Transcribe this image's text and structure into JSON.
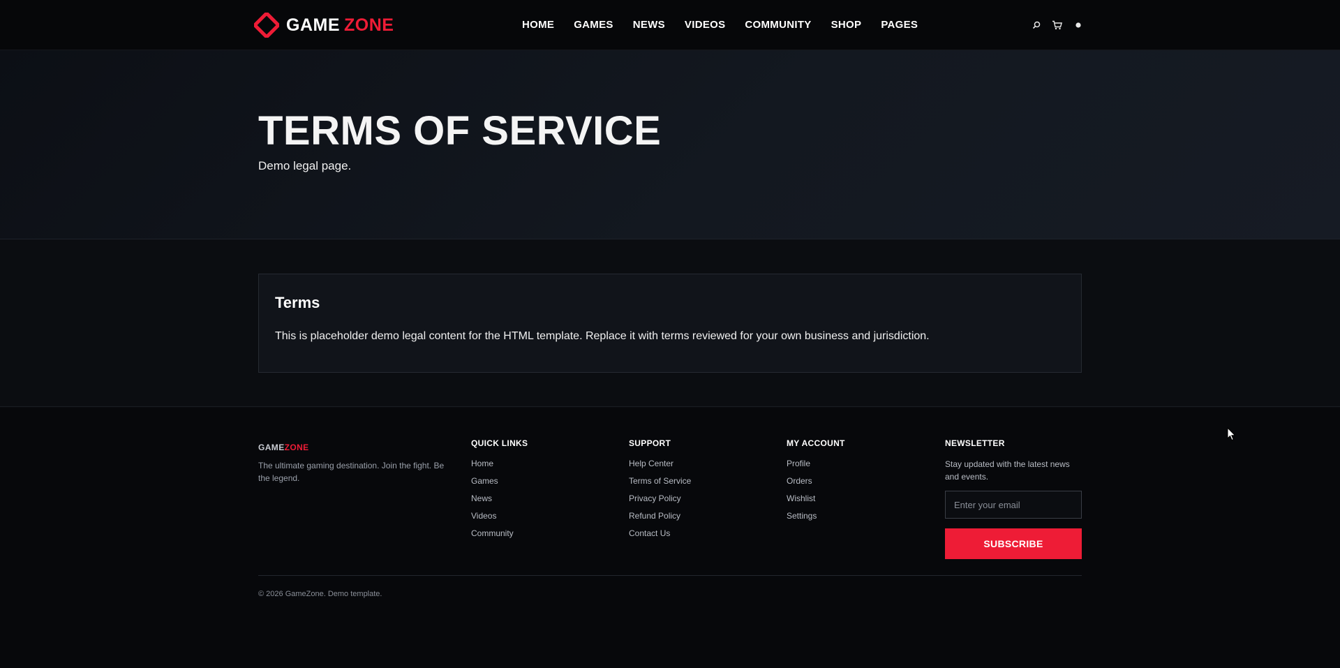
{
  "header": {
    "logo": {
      "word1": "GAME",
      "word2": "ZONE"
    },
    "nav": [
      {
        "label": "HOME"
      },
      {
        "label": "GAMES"
      },
      {
        "label": "NEWS"
      },
      {
        "label": "VIDEOS"
      },
      {
        "label": "COMMUNITY"
      },
      {
        "label": "SHOP"
      },
      {
        "label": "PAGES"
      }
    ],
    "icons": {
      "search": "⌕",
      "cart": "🛒",
      "account": "●"
    }
  },
  "hero": {
    "title": "TERMS OF SERVICE",
    "subtitle": "Demo legal page."
  },
  "content": {
    "card_title": "Terms",
    "card_text": "This is placeholder demo legal content for the HTML template. Replace it with terms reviewed for your own business and jurisdiction."
  },
  "footer": {
    "brand": {
      "word1": "GAME",
      "word2": "ZONE",
      "tagline": "The ultimate gaming destination. Join the fight. Be the legend."
    },
    "quick_links": {
      "title": "QUICK LINKS",
      "items": [
        "Home",
        "Games",
        "News",
        "Videos",
        "Community"
      ]
    },
    "support": {
      "title": "SUPPORT",
      "items": [
        "Help Center",
        "Terms of Service",
        "Privacy Policy",
        "Refund Policy",
        "Contact Us"
      ]
    },
    "my_account": {
      "title": "MY ACCOUNT",
      "items": [
        "Profile",
        "Orders",
        "Wishlist",
        "Settings"
      ]
    },
    "newsletter": {
      "title": "NEWSLETTER",
      "text": "Stay updated with the latest news and events.",
      "placeholder": "Enter your email",
      "button": "SUBSCRIBE"
    },
    "copyright": "© 2026 GameZone. Demo template."
  },
  "colors": {
    "accent": "#ee1c36",
    "background": "#0b0c10",
    "card": "#11141a"
  }
}
